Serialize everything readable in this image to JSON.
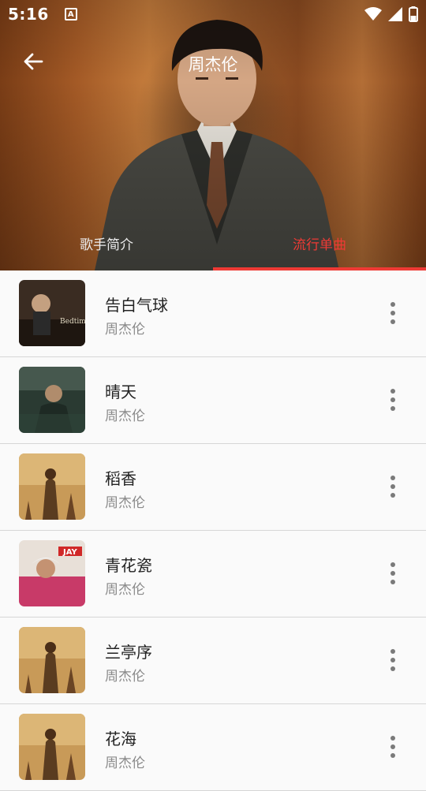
{
  "status_bar": {
    "time": "5:16",
    "notification_glyph": "A"
  },
  "header": {
    "title": "周杰伦",
    "back_icon": "arrow-left-icon"
  },
  "tabs": [
    {
      "label": "歌手简介",
      "active": false
    },
    {
      "label": "流行单曲",
      "active": true
    }
  ],
  "colors": {
    "accent": "#ef3a35",
    "list_background": "#fafafa",
    "divider": "#d6d6d6"
  },
  "songs": [
    {
      "title": "告白气球",
      "artist": "周杰伦",
      "cover_text": "Bedtime Stories"
    },
    {
      "title": "晴天",
      "artist": "周杰伦",
      "cover_text": ""
    },
    {
      "title": "稻香",
      "artist": "周杰伦",
      "cover_text": ""
    },
    {
      "title": "青花瓷",
      "artist": "周杰伦",
      "cover_text": "JAY"
    },
    {
      "title": "兰亭序",
      "artist": "周杰伦",
      "cover_text": ""
    },
    {
      "title": "花海",
      "artist": "周杰伦",
      "cover_text": ""
    }
  ]
}
